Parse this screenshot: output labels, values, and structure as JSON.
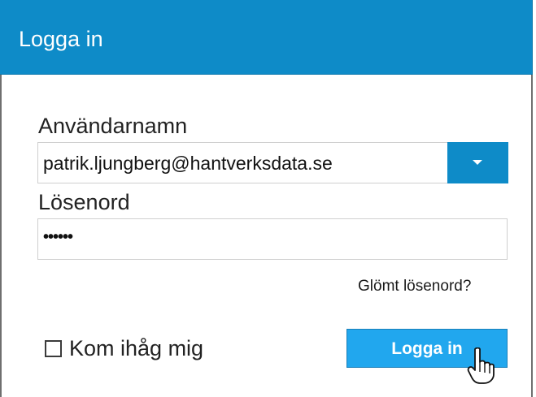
{
  "dialog": {
    "title": "Logga in"
  },
  "username": {
    "label": "Användarnamn",
    "value": "patrik.ljungberg@hantverksdata.se",
    "dropdown_icon": "chevron-down-icon"
  },
  "password": {
    "label": "Lösenord",
    "value": "••••••"
  },
  "forgot_password": {
    "label": "Glömt lösenord?"
  },
  "remember_me": {
    "label": "Kom ihåg mig",
    "checked": false
  },
  "login_button": {
    "label": "Logga in"
  },
  "cursor": {
    "icon": "hand-pointer-icon"
  },
  "colors": {
    "accent": "#0e8bc8",
    "button": "#21a7ee"
  }
}
